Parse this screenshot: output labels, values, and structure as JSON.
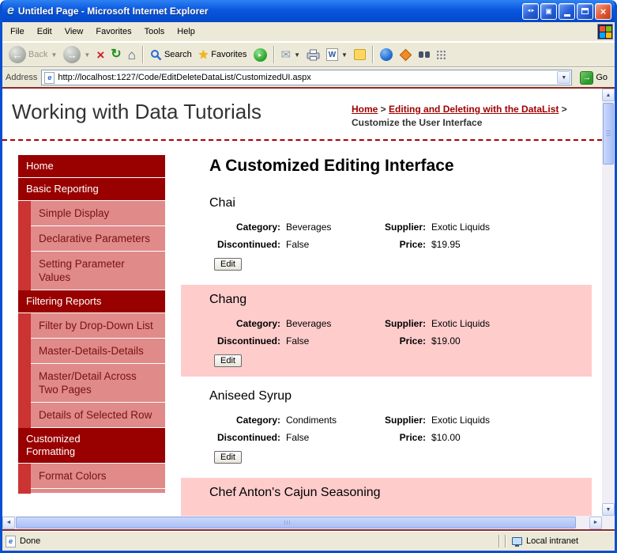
{
  "window": {
    "title": "Untitled Page - Microsoft Internet Explorer",
    "menu": {
      "file": "File",
      "edit": "Edit",
      "view": "View",
      "favorites": "Favorites",
      "tools": "Tools",
      "help": "Help"
    },
    "toolbar": {
      "back": "Back",
      "search": "Search",
      "favorites": "Favorites"
    },
    "address": {
      "label": "Address",
      "url": "http://localhost:1227/Code/EditDeleteDataList/CustomizedUI.aspx",
      "go": "Go"
    },
    "status": {
      "message": "Done",
      "zone": "Local intranet"
    }
  },
  "page": {
    "header": {
      "title": "Working with Data Tutorials",
      "breadcrumb": {
        "home": "Home",
        "sep1": " > ",
        "section": "Editing and Deleting with the DataList",
        "sep2": " > ",
        "current": "Customize the User Interface"
      }
    },
    "sidebar": {
      "items": [
        {
          "label": "Home"
        },
        {
          "label": "Basic Reporting"
        },
        {
          "label": "Simple Display"
        },
        {
          "label": "Declarative Parameters"
        },
        {
          "label": "Setting Parameter Values"
        },
        {
          "label": "Filtering Reports"
        },
        {
          "label": "Filter by Drop-Down List"
        },
        {
          "label": "Master-Details-Details"
        },
        {
          "label": "Master/Detail Across Two Pages"
        },
        {
          "label": "Details of Selected Row"
        },
        {
          "label": "Customized Formatting"
        },
        {
          "label": "Format Colors"
        }
      ]
    },
    "main": {
      "heading": "A Customized Editing Interface",
      "labels": {
        "category": "Category:",
        "supplier": "Supplier:",
        "discontinued": "Discontinued:",
        "price": "Price:",
        "edit": "Edit"
      },
      "products": [
        {
          "name": "Chai",
          "category": "Beverages",
          "supplier": "Exotic Liquids",
          "discontinued": "False",
          "price": "$19.95"
        },
        {
          "name": "Chang",
          "category": "Beverages",
          "supplier": "Exotic Liquids",
          "discontinued": "False",
          "price": "$19.00"
        },
        {
          "name": "Aniseed Syrup",
          "category": "Condiments",
          "supplier": "Exotic Liquids",
          "discontinued": "False",
          "price": "$10.00"
        },
        {
          "name": "Chef Anton's Cajun Seasoning"
        }
      ]
    }
  },
  "colors": {
    "nav_header_bg": "#990000",
    "nav_sub_bg": "#E08A8A",
    "nav_strip": "#CC3333",
    "alt_item_bg": "#FFCCCC",
    "link_red": "#A00000",
    "titlebar_blue": "#0A57E0"
  }
}
